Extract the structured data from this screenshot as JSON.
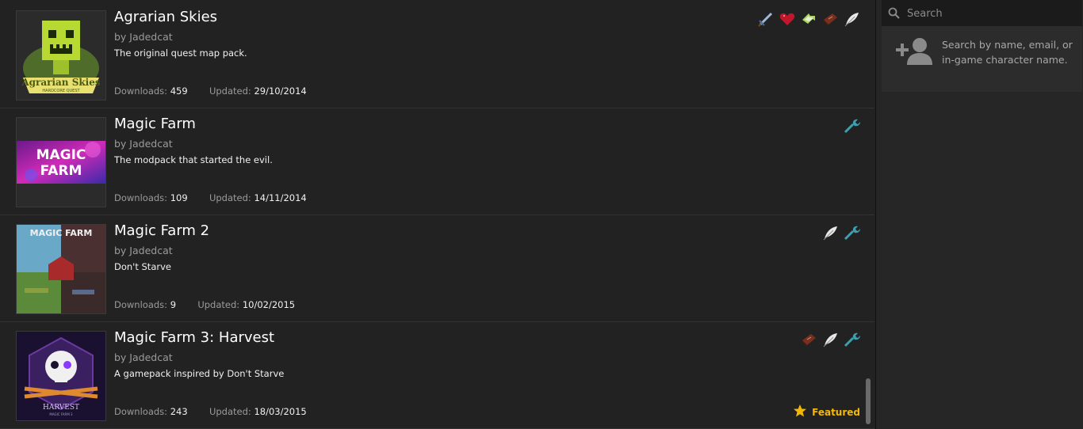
{
  "packs": [
    {
      "name": "Agrarian Skies",
      "author": "by Jadedcat",
      "description": "The original quest map pack.",
      "downloads_label": "Downloads:",
      "downloads": "459",
      "updated_label": "Updated:",
      "updated": "29/10/2014",
      "thumb_title": "Agrarian Skies",
      "thumb_subtitle": "HARDCORE QUEST",
      "tags": [
        "sword-icon",
        "heart-icon",
        "recycle-icon",
        "book-icon",
        "feather-icon"
      ]
    },
    {
      "name": "Magic Farm",
      "author": "by Jadedcat",
      "description": "The modpack that started the evil.",
      "downloads_label": "Downloads:",
      "downloads": "109",
      "updated_label": "Updated:",
      "updated": "14/11/2014",
      "thumb_title_1": "MAGIC",
      "thumb_title_2": "FARM",
      "tags": [
        "wrench-icon"
      ]
    },
    {
      "name": "Magic Farm 2",
      "author": "by Jadedcat",
      "description": "Don't Starve",
      "downloads_label": "Downloads:",
      "downloads": "9",
      "updated_label": "Updated:",
      "updated": "10/02/2015",
      "thumb_title": "MAGIC FARM",
      "tags": [
        "feather-icon",
        "wrench-icon"
      ]
    },
    {
      "name": "Magic Farm 3: Harvest",
      "author": "by Jadedcat",
      "description": "A gamepack inspired by Don't Starve",
      "downloads_label": "Downloads:",
      "downloads": "243",
      "updated_label": "Updated:",
      "updated": "18/03/2015",
      "thumb_title": "HARVEST",
      "thumb_subtitle": "MAGIC FARM 3",
      "featured_label": "Featured",
      "tags": [
        "book-icon",
        "feather-icon",
        "wrench-icon"
      ]
    }
  ],
  "sidebar": {
    "search_placeholder": "Search",
    "friend_hint": "Search by name, email, or in-game character name."
  },
  "colors": {
    "featured": "#f5b800",
    "wrench": "#3d9fb0"
  }
}
